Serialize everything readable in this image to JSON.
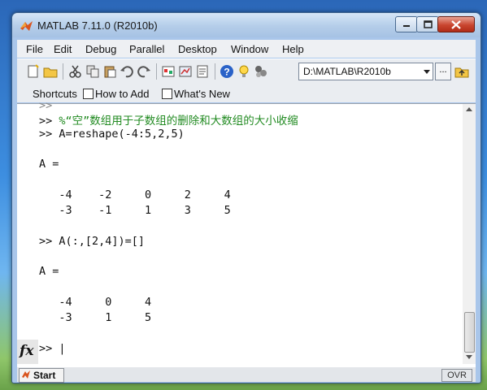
{
  "window": {
    "title": "MATLAB  7.11.0 (R2010b)"
  },
  "menu": [
    "File",
    "Edit",
    "Debug",
    "Parallel",
    "Desktop",
    "Window",
    "Help"
  ],
  "toolbar": {
    "current_folder": "D:\\MATLAB\\R2010b",
    "browse_label": "..."
  },
  "shortcuts": {
    "label": "Shortcuts",
    "how_to_add": "How to Add",
    "whats_new": "What's New"
  },
  "console": {
    "scroll_marker": ">>",
    "line1_prompt": ">> ",
    "line1_comment": "%“空”数组用于子数组的删除和大数组的大小收缩",
    "line2": ">> A=reshape(-4:5,2,5)",
    "a_label_1": "A =",
    "row1": "   -4    -2     0     2     4",
    "row2": "   -3    -1     1     3     5",
    "line3": ">> A(:,[2,4])=[]",
    "a_label_2": "A =",
    "row3": "   -4     0     4",
    "row4": "   -3     1     5",
    "prompt": ">> |"
  },
  "fx_label": "fx",
  "status": {
    "start_label": "Start",
    "ovr": "OVR"
  }
}
